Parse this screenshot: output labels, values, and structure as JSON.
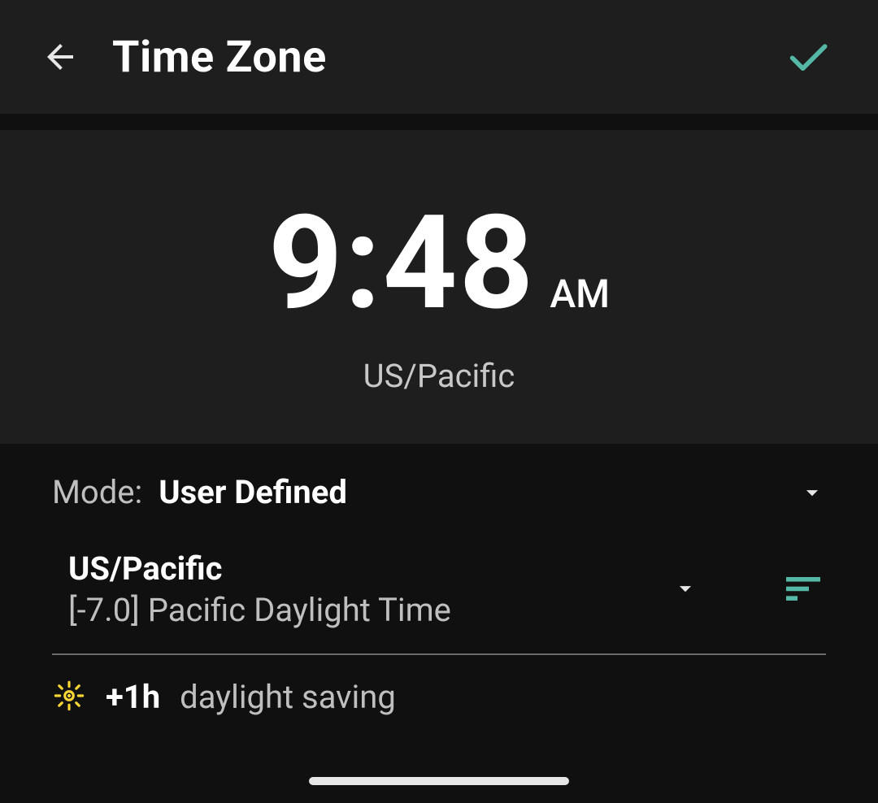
{
  "header": {
    "title": "Time Zone"
  },
  "clock": {
    "time": "9:48",
    "ampm": "AM",
    "timezone": "US/Pacific"
  },
  "modeRow": {
    "label": "Mode:",
    "value": "User Defined"
  },
  "tzRow": {
    "name": "US/Pacific",
    "desc": "[-7.0] Pacific Daylight Time"
  },
  "dst": {
    "offset": "+1h",
    "label": "daylight saving"
  },
  "colors": {
    "accent": "#55b8a7",
    "sunIcon": "#f7d635"
  }
}
